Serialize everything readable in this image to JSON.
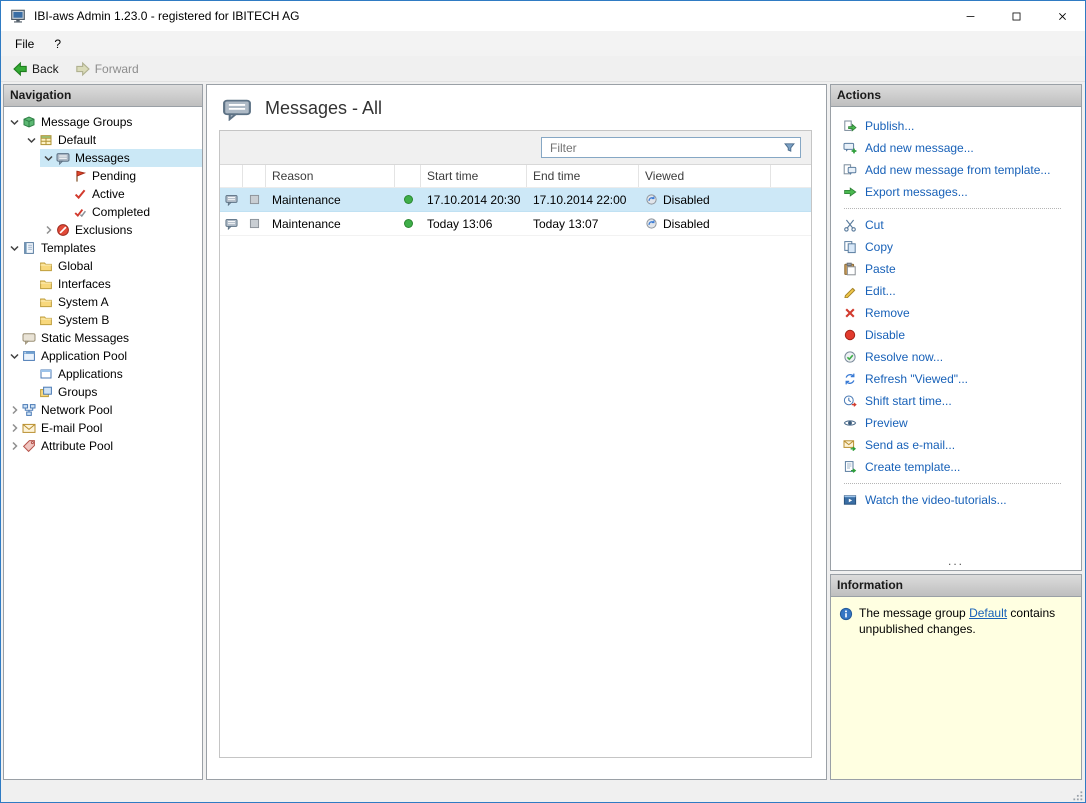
{
  "window": {
    "title": "IBI-aws Admin 1.23.0 - registered for IBITECH AG"
  },
  "menu": {
    "items": [
      {
        "label": "File"
      },
      {
        "label": "?"
      }
    ]
  },
  "toolbar": {
    "back_label": "Back",
    "forward_label": "Forward"
  },
  "navigation": {
    "header": "Navigation",
    "tree": [
      {
        "label": "Message Groups",
        "level": 0,
        "expander": "down",
        "icon": "message-groups",
        "selected": false
      },
      {
        "label": "Default",
        "level": 1,
        "expander": "down",
        "icon": "default-group",
        "selected": false
      },
      {
        "label": "Messages",
        "level": 2,
        "expander": "down",
        "icon": "messages",
        "selected": true
      },
      {
        "label": "Pending",
        "level": 3,
        "expander": "none",
        "icon": "pending",
        "selected": false
      },
      {
        "label": "Active",
        "level": 3,
        "expander": "none",
        "icon": "active",
        "selected": false
      },
      {
        "label": "Completed",
        "level": 3,
        "expander": "none",
        "icon": "completed",
        "selected": false
      },
      {
        "label": "Exclusions",
        "level": 2,
        "expander": "right",
        "icon": "exclusions",
        "selected": false
      },
      {
        "label": "Templates",
        "level": 0,
        "expander": "down",
        "icon": "templates",
        "selected": false
      },
      {
        "label": "Global",
        "level": 1,
        "expander": "none",
        "icon": "folder",
        "selected": false
      },
      {
        "label": "Interfaces",
        "level": 1,
        "expander": "none",
        "icon": "folder",
        "selected": false
      },
      {
        "label": "System A",
        "level": 1,
        "expander": "none",
        "icon": "folder",
        "selected": false
      },
      {
        "label": "System B",
        "level": 1,
        "expander": "none",
        "icon": "folder",
        "selected": false
      },
      {
        "label": "Static Messages",
        "level": 0,
        "expander": "none",
        "icon": "static-messages",
        "selected": false
      },
      {
        "label": "Application Pool",
        "level": 0,
        "expander": "down",
        "icon": "application-pool",
        "selected": false
      },
      {
        "label": "Applications",
        "level": 1,
        "expander": "none",
        "icon": "applications",
        "selected": false
      },
      {
        "label": "Groups",
        "level": 1,
        "expander": "none",
        "icon": "groups",
        "selected": false
      },
      {
        "label": "Network Pool",
        "level": 0,
        "expander": "right",
        "icon": "network-pool",
        "selected": false
      },
      {
        "label": "E-mail Pool",
        "level": 0,
        "expander": "right",
        "icon": "email-pool",
        "selected": false
      },
      {
        "label": "Attribute Pool",
        "level": 0,
        "expander": "right",
        "icon": "attribute-pool",
        "selected": false
      }
    ]
  },
  "main": {
    "title": "Messages - All",
    "filter_placeholder": "Filter",
    "table": {
      "columns": [
        "",
        "",
        "Reason",
        "",
        "Start time",
        "End time",
        "Viewed"
      ],
      "rows": [
        {
          "reason": "Maintenance",
          "status_color": "#3fae49",
          "start_time": "17.10.2014 20:30",
          "end_time": "17.10.2014 22:00",
          "viewed": "Disabled",
          "selected": true
        },
        {
          "reason": "Maintenance",
          "status_color": "#3fae49",
          "start_time": "Today 13:06",
          "end_time": "Today 13:07",
          "viewed": "Disabled",
          "selected": false
        }
      ]
    }
  },
  "actions": {
    "header": "Actions",
    "items": [
      {
        "type": "action",
        "label": "Publish...",
        "icon": "publish"
      },
      {
        "type": "action",
        "label": "Add new message...",
        "icon": "add-message"
      },
      {
        "type": "action",
        "label": "Add new message from template...",
        "icon": "add-message-template"
      },
      {
        "type": "action",
        "label": "Export messages...",
        "icon": "export"
      },
      {
        "type": "separator"
      },
      {
        "type": "action",
        "label": "Cut",
        "icon": "cut"
      },
      {
        "type": "action",
        "label": "Copy",
        "icon": "copy"
      },
      {
        "type": "action",
        "label": "Paste",
        "icon": "paste"
      },
      {
        "type": "action",
        "label": "Edit...",
        "icon": "edit"
      },
      {
        "type": "action",
        "label": "Remove",
        "icon": "remove"
      },
      {
        "type": "action",
        "label": "Disable",
        "icon": "disable"
      },
      {
        "type": "action",
        "label": "Resolve now...",
        "icon": "resolve"
      },
      {
        "type": "action",
        "label": "Refresh \"Viewed\"...",
        "icon": "refresh-viewed"
      },
      {
        "type": "action",
        "label": "Shift start time...",
        "icon": "shift-start-time"
      },
      {
        "type": "action",
        "label": "Preview",
        "icon": "preview"
      },
      {
        "type": "action",
        "label": "Send as e-mail...",
        "icon": "send-email"
      },
      {
        "type": "action",
        "label": "Create template...",
        "icon": "create-template"
      },
      {
        "type": "separator"
      },
      {
        "type": "action",
        "label": "Watch the video-tutorials...",
        "icon": "video-tutorials"
      }
    ],
    "overflow_label": "..."
  },
  "information": {
    "header": "Information",
    "text_before": "The message group ",
    "link_text": "Default",
    "text_after": " contains unpublished changes."
  },
  "colors": {
    "accent_link": "#1861b8",
    "selection": "#cbe8f6",
    "info_background": "#ffffe1",
    "status_green": "#3fae49"
  }
}
